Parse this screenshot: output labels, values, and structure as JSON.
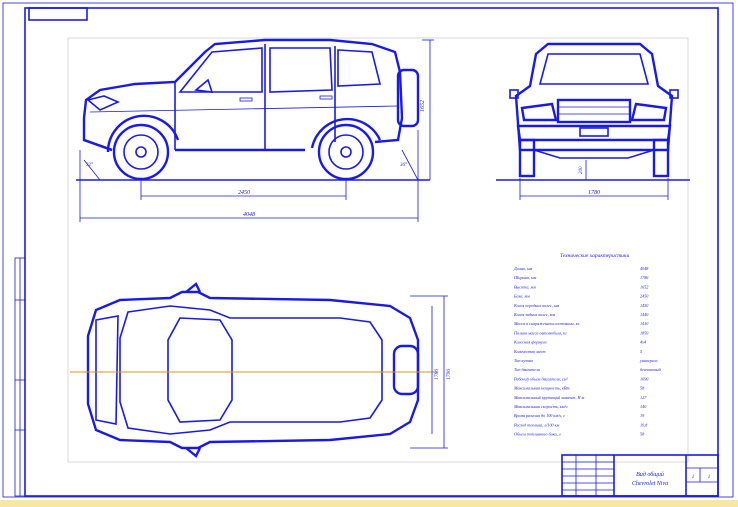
{
  "drawing": {
    "title": "Технические характеристики",
    "dims": {
      "side_height": "1652",
      "side_wheelbase": "2450",
      "side_length": "4048",
      "front_width": "1780",
      "front_clearance": "200",
      "top_width": "1786",
      "top_width2": "1790",
      "approach_angle": "32°",
      "departure_angle": "36°"
    },
    "specs": [
      {
        "key": "Длина, мм",
        "val": "4048"
      },
      {
        "key": "Ширина, мм",
        "val": "1786"
      },
      {
        "key": "Высота, мм",
        "val": "1652"
      },
      {
        "key": "База, мм",
        "val": "2450"
      },
      {
        "key": "Колея передних колес, мм",
        "val": "1450"
      },
      {
        "key": "Колея задних колес, мм",
        "val": "1440"
      },
      {
        "key": "Масса в снаряженном состоянии, кг",
        "val": "1410"
      },
      {
        "key": "Полная масса автомобиля, кг",
        "val": "1850"
      },
      {
        "key": "Колесная формула",
        "val": "4х4"
      },
      {
        "key": "Количество мест",
        "val": "5"
      },
      {
        "key": "Тип кузова",
        "val": "универсал"
      },
      {
        "key": "Тип двигателя",
        "val": "бензиновый"
      },
      {
        "key": "Рабочий объем двигателя, см³",
        "val": "1690"
      },
      {
        "key": "Максимальная мощность, кВт",
        "val": "58"
      },
      {
        "key": "Максимальный крутящий момент, Н·м",
        "val": "127"
      },
      {
        "key": "Максимальная скорость, км/ч",
        "val": "140"
      },
      {
        "key": "Время разгона до 100 км/ч, с",
        "val": "19"
      },
      {
        "key": "Расход топлива, л/100 км",
        "val": "10,8"
      },
      {
        "key": "Объем топливного бака, л",
        "val": "58"
      }
    ],
    "stamp": {
      "title_line1": "Вид общий",
      "title_line2": "Chevrolet Niva",
      "sheet": "1",
      "sheets": "1"
    }
  }
}
